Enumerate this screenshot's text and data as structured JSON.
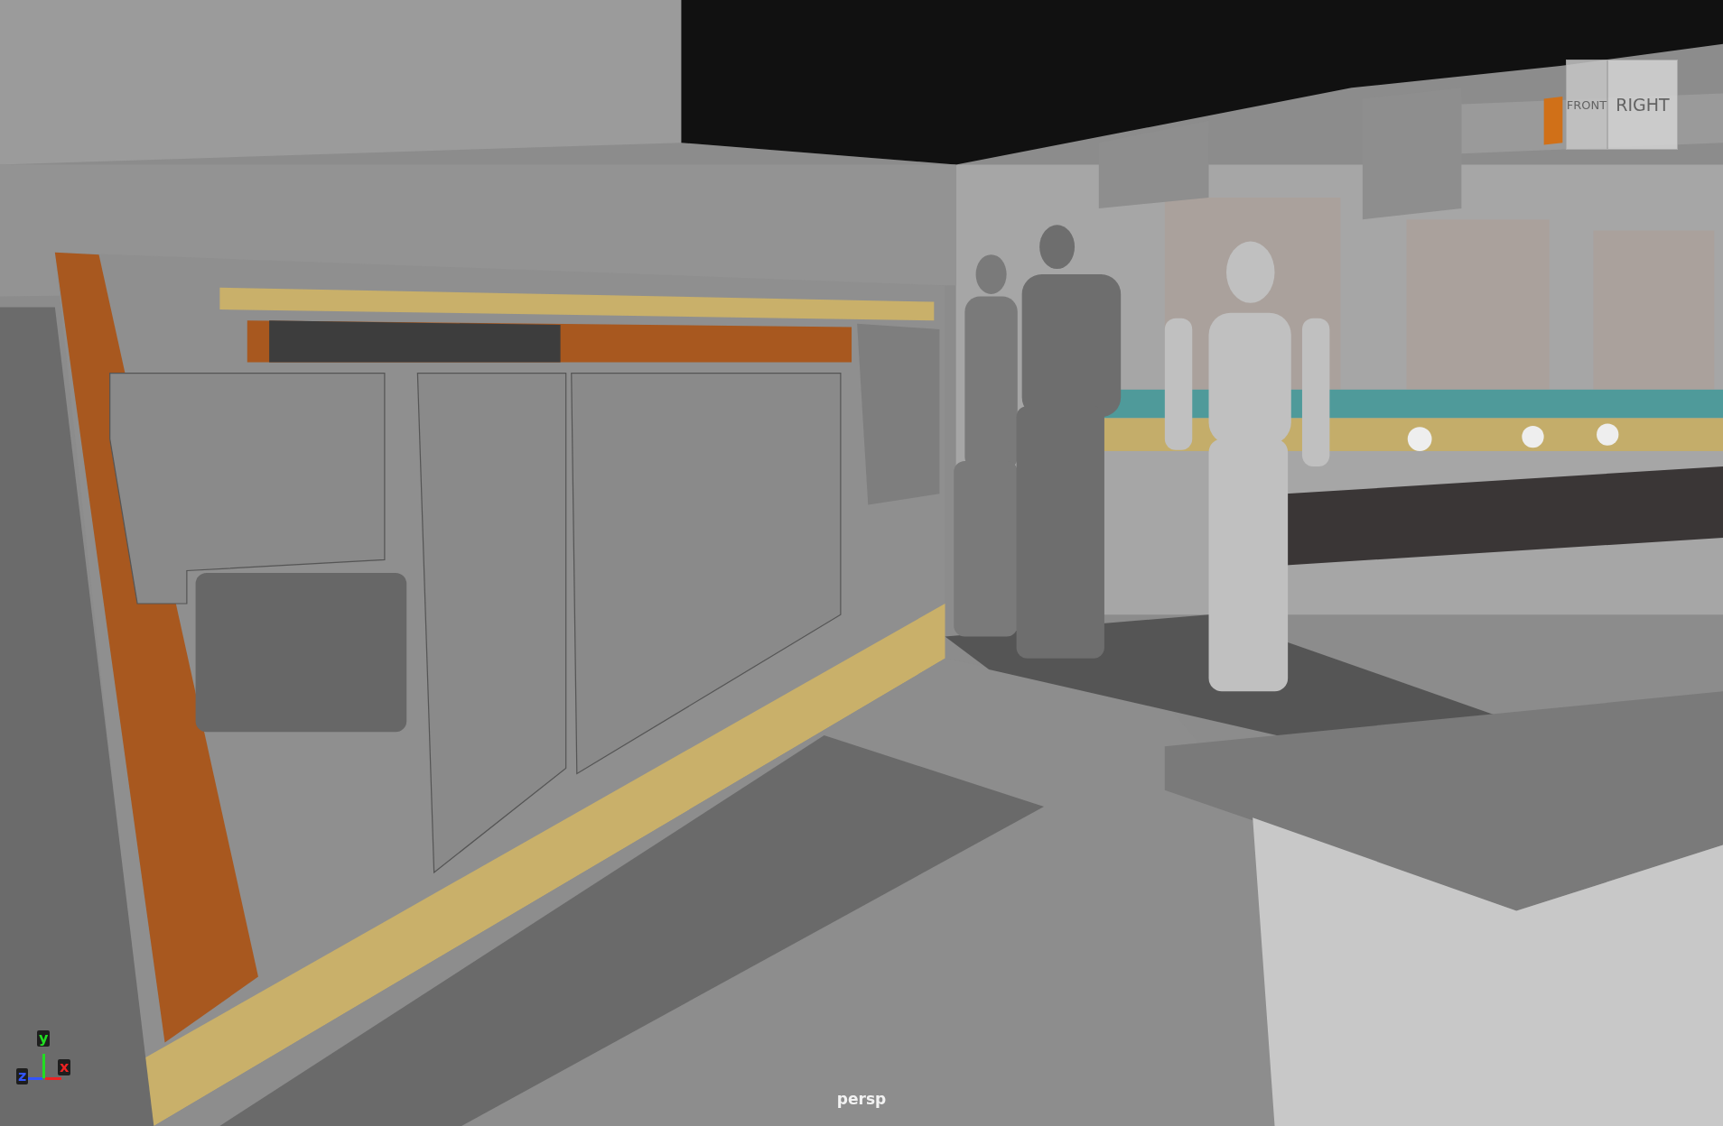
{
  "viewport": {
    "camera_label": "persp"
  },
  "view_cube": {
    "faces": [
      {
        "label": "FRONT",
        "kind": "front"
      },
      {
        "label": "RIGHT",
        "kind": "right"
      }
    ]
  },
  "axis_indicator": {
    "axes": [
      {
        "label": "y",
        "kind": "y",
        "color": "#22dd22"
      },
      {
        "label": "z",
        "kind": "z",
        "color": "#3355ff"
      },
      {
        "label": "x",
        "kind": "x",
        "color": "#ee2222"
      }
    ]
  }
}
